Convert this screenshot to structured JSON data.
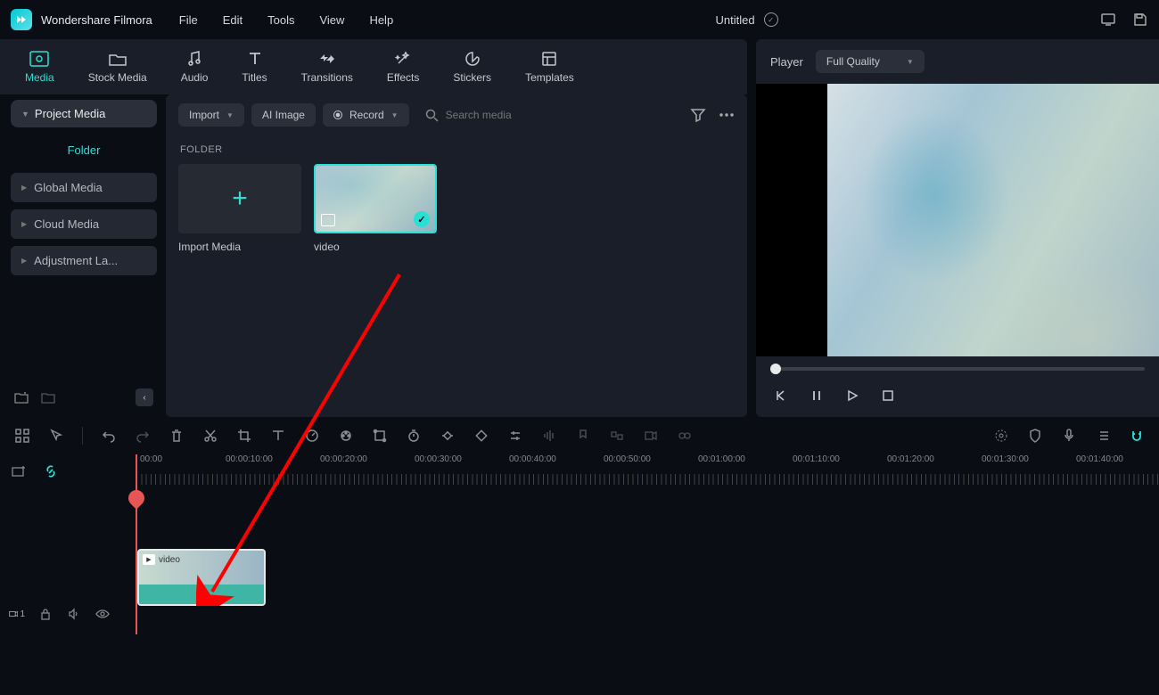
{
  "app": {
    "name": "Wondershare Filmora",
    "document": "Untitled"
  },
  "menu": [
    "File",
    "Edit",
    "Tools",
    "View",
    "Help"
  ],
  "mainTabs": [
    {
      "label": "Media",
      "active": true
    },
    {
      "label": "Stock Media"
    },
    {
      "label": "Audio"
    },
    {
      "label": "Titles"
    },
    {
      "label": "Transitions"
    },
    {
      "label": "Effects"
    },
    {
      "label": "Stickers"
    },
    {
      "label": "Templates"
    }
  ],
  "sidebar": {
    "primary": "Project Media",
    "folderHeader": "Folder",
    "items": [
      "Global Media",
      "Cloud Media",
      "Adjustment La..."
    ]
  },
  "contentToolbar": {
    "import": "Import",
    "aiImage": "AI Image",
    "record": "Record",
    "searchPlaceholder": "Search media"
  },
  "folderLabel": "FOLDER",
  "mediaItems": {
    "importLabel": "Import Media",
    "video": "video"
  },
  "player": {
    "label": "Player",
    "quality": "Full Quality"
  },
  "ruler": [
    "00:00",
    "00:00:10:00",
    "00:00:20:00",
    "00:00:30:00",
    "00:00:40:00",
    "00:00:50:00",
    "00:01:00:00",
    "00:01:10:00",
    "00:01:20:00",
    "00:01:30:00",
    "00:01:40:00"
  ],
  "clip": {
    "label": "video"
  },
  "colors": {
    "accent": "#29e0d5",
    "bg": "#0a0d14",
    "panel": "#1a1e28",
    "annotation": "#ff0000"
  }
}
